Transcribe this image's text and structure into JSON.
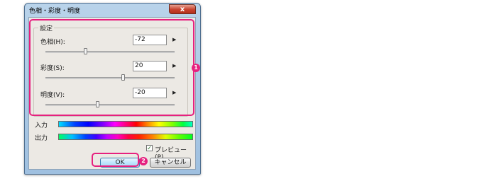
{
  "window": {
    "title": "色相・彩度・明度",
    "close_glyph": "x"
  },
  "settings": {
    "group_label": "設定",
    "hue": {
      "label": "色相(H):",
      "value": "-72",
      "slider_fraction": 0.31
    },
    "saturation": {
      "label": "彩度(S):",
      "value": "20",
      "slider_fraction": 0.6
    },
    "lightness": {
      "label": "明度(V):",
      "value": "-20",
      "slider_fraction": 0.4
    },
    "arrow_glyph": "▶"
  },
  "color_bars": {
    "input_label": "入力",
    "output_label": "出力"
  },
  "preview": {
    "label": "プレビュー(P)",
    "checked": true,
    "check_glyph": "✓"
  },
  "buttons": {
    "ok": "OK",
    "cancel": "キャンセル"
  },
  "annotations": {
    "color": "#e6217f",
    "badge1": "1",
    "badge2": "2"
  }
}
